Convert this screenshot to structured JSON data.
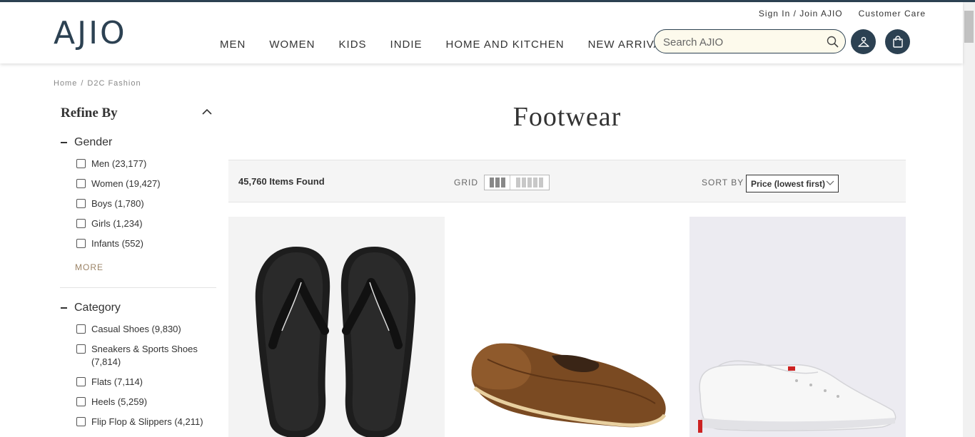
{
  "brand": {
    "logo": "AJIO",
    "color": "#2c4152"
  },
  "header": {
    "top_links": [
      "Sign In / Join AJIO",
      "Customer Care"
    ],
    "nav": [
      "MEN",
      "WOMEN",
      "KIDS",
      "INDIE",
      "HOME AND KITCHEN",
      "NEW ARRIVALS"
    ],
    "search": {
      "placeholder": "Search AJIO",
      "value": ""
    },
    "icons": [
      "search-icon",
      "user-icon",
      "bag-icon"
    ]
  },
  "breadcrumb": [
    "Home",
    "/",
    "D2C Fashion"
  ],
  "sidebar": {
    "title": "Refine By",
    "facets": [
      {
        "title": "Gender",
        "options": [
          "Men (23,177)",
          "Women (19,427)",
          "Boys (1,780)",
          "Girls (1,234)",
          "Infants (552)"
        ],
        "more": "MORE"
      },
      {
        "title": "Category",
        "options": [
          "Casual Shoes (9,830)",
          "Sneakers & Sports Shoes (7,814)",
          "Flats (7,114)",
          "Heels (5,259)",
          "Flip Flop & Slippers (4,211)"
        ]
      }
    ]
  },
  "main": {
    "title": "Footwear",
    "items_found": "45,760 Items Found",
    "grid_label": "GRID",
    "sort_label": "SORT BY",
    "sort_value": "Price (lowest first)",
    "products": [
      {
        "image": "black-flip-flops"
      },
      {
        "image": "brown-leather-loafer"
      },
      {
        "image": "white-sneaker"
      }
    ]
  }
}
